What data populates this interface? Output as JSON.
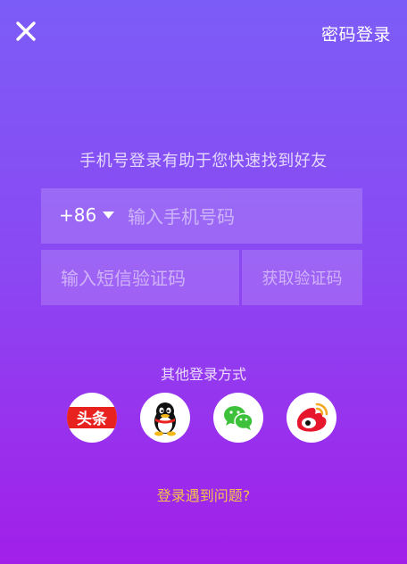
{
  "header": {
    "close_icon": "close-icon",
    "password_login_label": "密码登录"
  },
  "hint": "手机号登录有助于您快速找到好友",
  "phone": {
    "country_code": "+86",
    "dropdown_icon": "caret-down-icon",
    "placeholder": "输入手机号码"
  },
  "sms": {
    "placeholder": "输入短信验证码",
    "get_code_label": "获取验证码"
  },
  "other_login": {
    "label": "其他登录方式",
    "toutiao_text": "头条",
    "providers": [
      "toutiao-icon",
      "qq-icon",
      "wechat-icon",
      "weibo-icon"
    ]
  },
  "help_link": "登录遇到问题?",
  "colors": {
    "bg_top": "#7c5cf6",
    "bg_bottom": "#a21fe9",
    "help_link": "#f2c14e",
    "toutiao_red": "#e8231f",
    "wechat_green": "#3ec13a",
    "weibo_red": "#e6162d",
    "weibo_orange": "#f5a623"
  }
}
